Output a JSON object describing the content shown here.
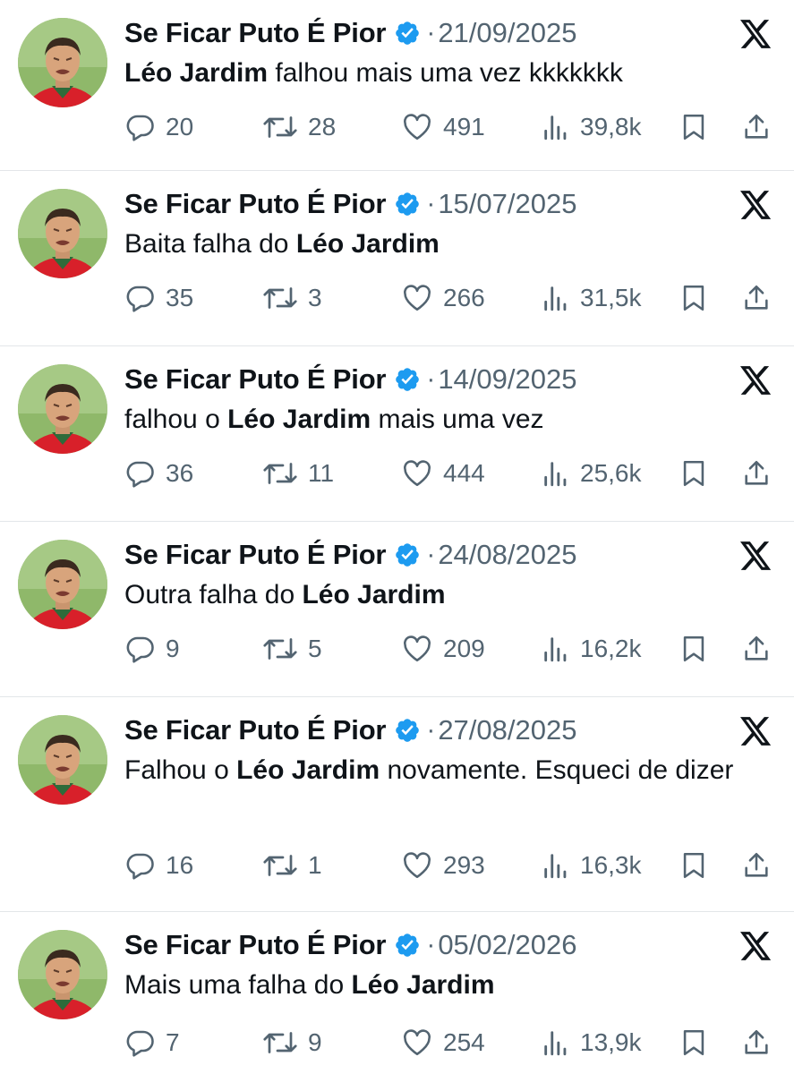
{
  "colors": {
    "text": "#0f1419",
    "muted": "#536471",
    "verified": "#1d9bf0",
    "divider": "#e3e6e9"
  },
  "icons": {
    "reply": "reply-icon",
    "retweet": "retweet-icon",
    "like": "heart-icon",
    "views": "views-icon",
    "bookmark": "bookmark-icon",
    "share": "share-icon",
    "platform": "x-logo-icon",
    "verified": "verified-badge-icon"
  },
  "tweets": [
    {
      "name": "Se Ficar Puto É Pior",
      "separator": "·",
      "date": "21/09/2025",
      "text_parts": [
        {
          "t": "Léo Jardim",
          "b": true
        },
        {
          "t": " falhou mais uma vez kkkkkkk",
          "b": false
        }
      ],
      "replies": "20",
      "retweets": "28",
      "likes": "491",
      "views": "39,8k"
    },
    {
      "name": "Se Ficar Puto É Pior",
      "separator": "·",
      "date": "15/07/2025",
      "text_parts": [
        {
          "t": "Baita falha do ",
          "b": false
        },
        {
          "t": "Léo Jardim",
          "b": true
        }
      ],
      "replies": "35",
      "retweets": "3",
      "likes": "266",
      "views": "31,5k"
    },
    {
      "name": "Se Ficar Puto É Pior",
      "separator": "·",
      "date": "14/09/2025",
      "text_parts": [
        {
          "t": "falhou o ",
          "b": false
        },
        {
          "t": "Léo Jardim",
          "b": true
        },
        {
          "t": " mais uma vez",
          "b": false
        }
      ],
      "replies": "36",
      "retweets": "11",
      "likes": "444",
      "views": "25,6k"
    },
    {
      "name": "Se Ficar Puto É Pior",
      "separator": "·",
      "date": "24/08/2025",
      "text_parts": [
        {
          "t": "Outra falha do ",
          "b": false
        },
        {
          "t": "Léo Jardim",
          "b": true
        }
      ],
      "replies": "9",
      "retweets": "5",
      "likes": "209",
      "views": "16,2k"
    },
    {
      "name": "Se Ficar Puto É Pior",
      "separator": "·",
      "date": "27/08/2025",
      "text_parts": [
        {
          "t": "Falhou o ",
          "b": false
        },
        {
          "t": "Léo Jardim",
          "b": true
        },
        {
          "t": " novamente. Esqueci de dizer",
          "b": false
        }
      ],
      "replies": "16",
      "retweets": "1",
      "likes": "293",
      "views": "16,3k"
    },
    {
      "name": "Se Ficar Puto É Pior",
      "separator": "·",
      "date": "05/02/2026",
      "text_parts": [
        {
          "t": "Mais uma falha do ",
          "b": false
        },
        {
          "t": "Léo Jardim",
          "b": true
        }
      ],
      "replies": "7",
      "retweets": "9",
      "likes": "254",
      "views": "13,9k"
    }
  ]
}
